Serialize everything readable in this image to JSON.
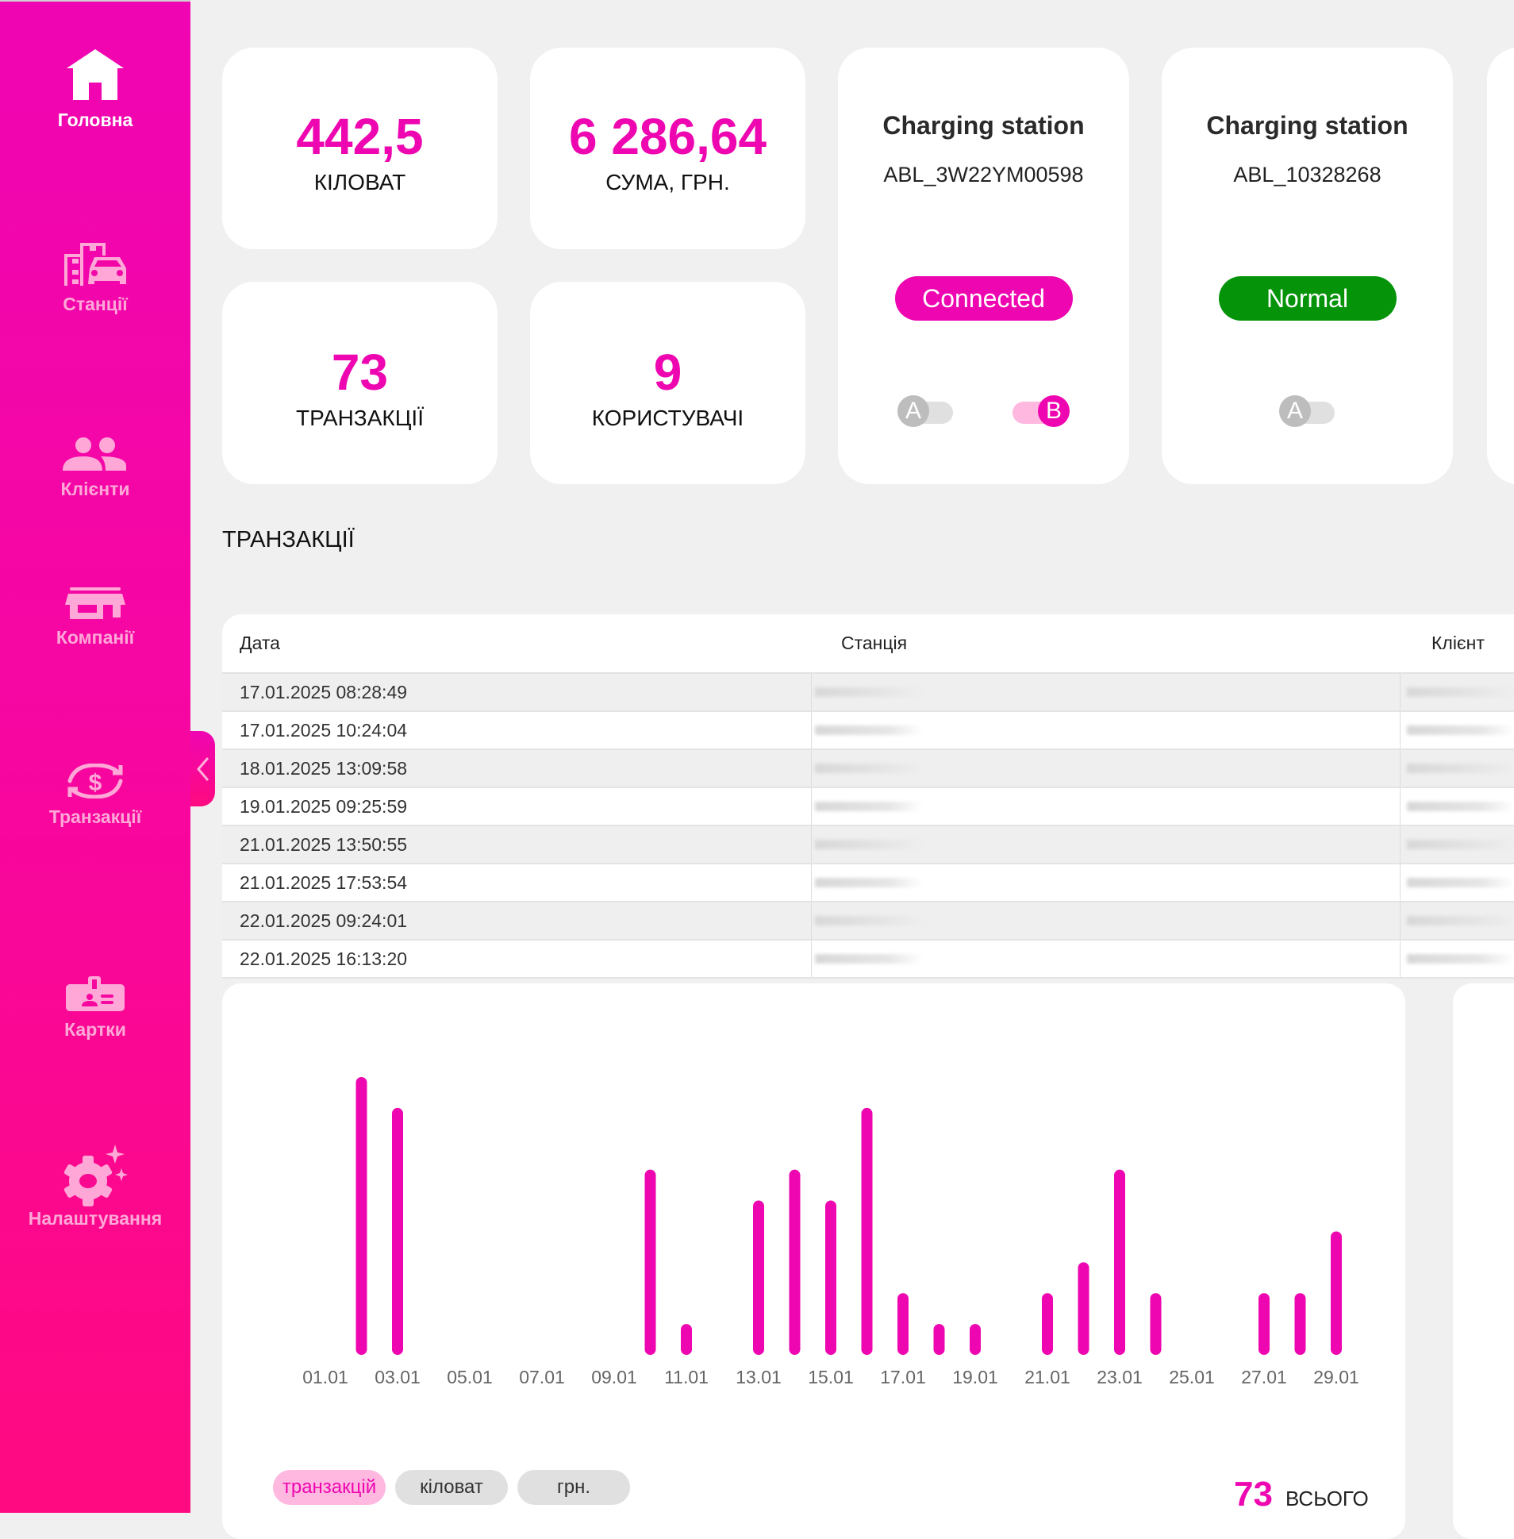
{
  "sidebar": {
    "items": [
      {
        "label": "Головна",
        "icon": "home-icon",
        "active": true
      },
      {
        "label": "Станції",
        "icon": "station-car-icon"
      },
      {
        "label": "Клієнти",
        "icon": "users-icon"
      },
      {
        "label": "Компанії",
        "icon": "store-icon"
      },
      {
        "label": "Транзакції",
        "icon": "dollar-exchange-icon"
      },
      {
        "label": "Картки",
        "icon": "id-card-icon"
      },
      {
        "label": "Налаштування",
        "icon": "gear-sparkle-icon"
      }
    ],
    "collapse_icon": "chevron-left-icon"
  },
  "stats": {
    "kw": {
      "value": "442,5",
      "label": "КІЛОВАТ"
    },
    "sum": {
      "value": "6 286,64",
      "label": "СУМА, ГРН."
    },
    "transactions": {
      "value": "73",
      "label": "ТРАНЗАКЦІЇ"
    },
    "users": {
      "value": "9",
      "label": "КОРИСТУВАЧІ"
    }
  },
  "stations": [
    {
      "title": "Charging station",
      "id": "ABL_3W22YM00598",
      "status": "Connected",
      "status_color": "#ee06b0",
      "connectors": [
        {
          "label": "A",
          "on": false
        },
        {
          "label": "B",
          "on": true
        }
      ]
    },
    {
      "title": "Charging station",
      "id": "ABL_10328268",
      "status": "Normal",
      "status_color": "#05930a",
      "connectors": [
        {
          "label": "A",
          "on": false
        }
      ]
    }
  ],
  "transactions": {
    "title": "ТРАНЗАКЦІЇ",
    "columns": [
      "Дата",
      "Станція",
      "Клієнт"
    ],
    "rows": [
      "17.01.2025 08:28:49",
      "17.01.2025 10:24:04",
      "18.01.2025 13:09:58",
      "19.01.2025 09:25:59",
      "21.01.2025 13:50:55",
      "21.01.2025 17:53:54",
      "22.01.2025 09:24:01",
      "22.01.2025 16:13:20"
    ]
  },
  "chart_data": {
    "type": "bar",
    "color": "#ee06b0",
    "categories": [
      "01.01",
      "02.01",
      "03.01",
      "04.01",
      "05.01",
      "06.01",
      "07.01",
      "08.01",
      "09.01",
      "10.01",
      "11.01",
      "12.01",
      "13.01",
      "14.01",
      "15.01",
      "16.01",
      "17.01",
      "18.01",
      "19.01",
      "20.01",
      "21.01",
      "22.01",
      "23.01",
      "24.01",
      "25.01",
      "26.01",
      "27.01",
      "28.01",
      "29.01"
    ],
    "tick_labels": [
      "01.01",
      "03.01",
      "05.01",
      "07.01",
      "09.01",
      "11.01",
      "13.01",
      "15.01",
      "17.01",
      "19.01",
      "21.01",
      "23.01",
      "25.01",
      "27.01",
      "29.01"
    ],
    "values": [
      0,
      9,
      8,
      0,
      0,
      0,
      0,
      0,
      0,
      6,
      1,
      0,
      5,
      6,
      5,
      8,
      2,
      1,
      1,
      0,
      2,
      3,
      6,
      2,
      0,
      0,
      2,
      2,
      4
    ],
    "ylim": [
      0,
      9
    ]
  },
  "chart_controls": {
    "options": [
      "транзакцій",
      "кіловат",
      "грн."
    ],
    "selected": 0,
    "total": "73",
    "total_label": "ВСЬОГО"
  }
}
